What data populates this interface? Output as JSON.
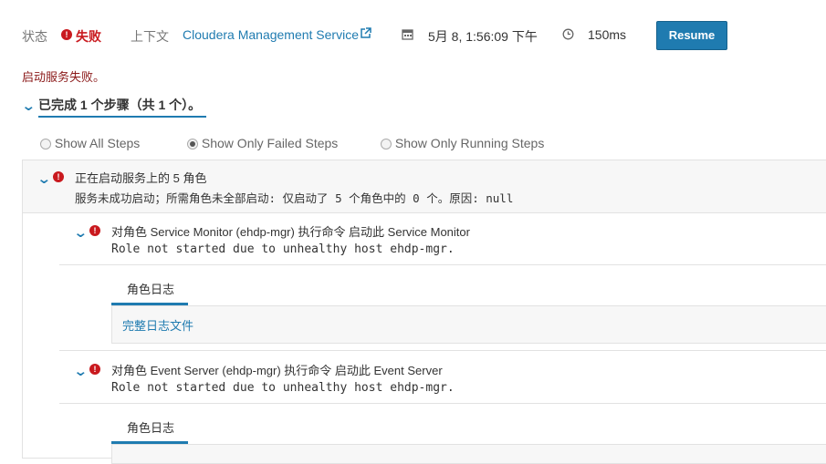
{
  "header": {
    "status_label": "状态",
    "status_value": "失败",
    "context_label": "上下文",
    "context_value": "Cloudera Management Service",
    "date_value": "5月 8, 1:56:09 下午",
    "duration_value": "150ms",
    "resume_label": "Resume"
  },
  "message": "启动服务失败。",
  "summary": "已完成 1 个步骤（共 1 个）。",
  "filters": {
    "all": "Show All Steps",
    "failed": "Show Only Failed Steps",
    "running": "Show Only Running Steps",
    "selected": "failed"
  },
  "step": {
    "title": "正在启动服务上的 5 角色",
    "detail": "服务未成功启动；所需角色未全部启动: 仅启动了 5 个角色中的 0 个。原因: null",
    "substeps": [
      {
        "title": "对角色 Service Monitor (ehdp-mgr) 执行命令 启动此 Service Monitor",
        "detail": "Role not started due to unhealthy host ehdp-mgr.",
        "tab": "角色日志",
        "log_link": "完整日志文件"
      },
      {
        "title": "对角色 Event Server (ehdp-mgr) 执行命令 启动此 Event Server",
        "detail": "Role not started due to unhealthy host ehdp-mgr.",
        "tab": "角色日志"
      }
    ]
  },
  "icons": {
    "error": "exclamation-circle-icon",
    "external": "external-link-icon",
    "calendar": "calendar-icon",
    "clock": "clock-icon",
    "chevron": "chevron-down-icon"
  },
  "colors": {
    "accent": "#1f7bb0",
    "error": "#c9191e",
    "message": "#8b1a1a"
  }
}
